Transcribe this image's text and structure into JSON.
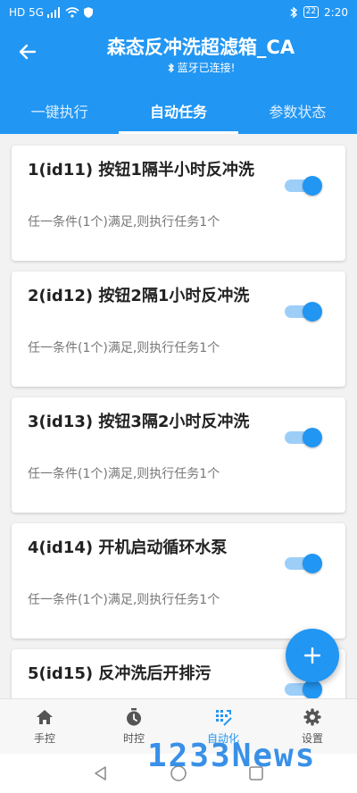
{
  "status": {
    "left_text": "HD 5G",
    "battery": "22",
    "time": "2:20"
  },
  "header": {
    "title": "森态反冲洗超滤箱_CA",
    "subtitle": "蓝牙已连接!",
    "tabs": [
      "一键执行",
      "自动任务",
      "参数状态"
    ]
  },
  "tasks": [
    {
      "title": "1(id11) 按钮1隔半小时反冲洗",
      "desc": "任一条件(1个)满足,则执行任务1个",
      "enabled": true
    },
    {
      "title": "2(id12) 按钮2隔1小时反冲洗",
      "desc": "任一条件(1个)满足,则执行任务1个",
      "enabled": true
    },
    {
      "title": "3(id13) 按钮3隔2小时反冲洗",
      "desc": "任一条件(1个)满足,则执行任务1个",
      "enabled": true
    },
    {
      "title": "4(id14) 开机启动循环水泵",
      "desc": "任一条件(1个)满足,则执行任务1个",
      "enabled": true
    },
    {
      "title": "5(id15) 反冲洗后开排污",
      "desc": "",
      "enabled": true
    }
  ],
  "fab": {
    "icon": "plus-icon"
  },
  "bottom_nav": [
    {
      "label": "手控",
      "icon": "home-icon"
    },
    {
      "label": "时控",
      "icon": "stopwatch-icon"
    },
    {
      "label": "自动化",
      "icon": "automation-icon"
    },
    {
      "label": "设置",
      "icon": "gear-icon"
    }
  ],
  "watermark": "1233News",
  "colors": {
    "primary": "#2196f3",
    "toggle_track": "#9ccef8"
  }
}
